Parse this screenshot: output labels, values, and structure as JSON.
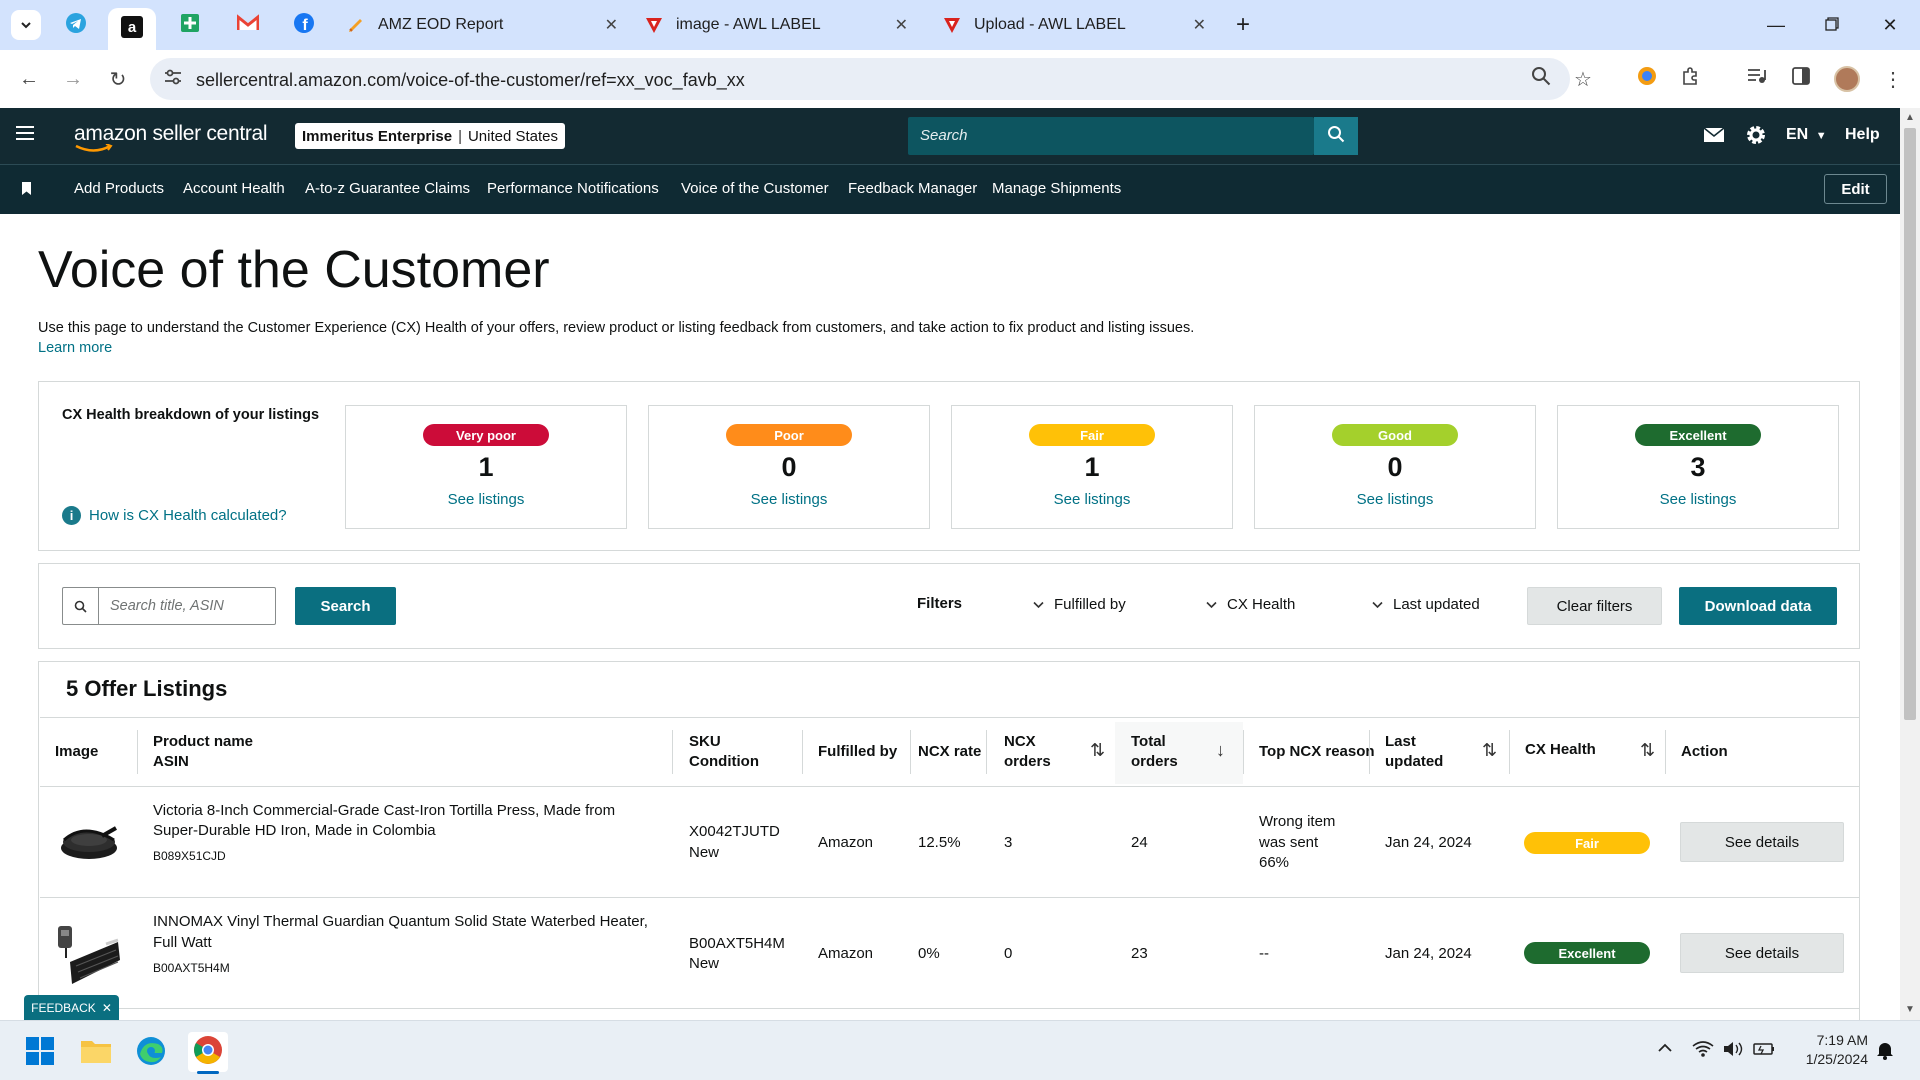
{
  "browser": {
    "tabs": [
      {
        "title": "AMZ EOD Report"
      },
      {
        "title": "image - AWL LABEL"
      },
      {
        "title": "Upload - AWL LABEL"
      }
    ],
    "url": "sellercentral.amazon.com/voice-of-the-customer/ref=xx_voc_favb_xx"
  },
  "header": {
    "logo": "amazon seller central",
    "store_name": "Immeritus Enterprise",
    "marketplace": "United States",
    "search_placeholder": "Search",
    "language": "EN",
    "help": "Help"
  },
  "nav": {
    "items": [
      "Add Products",
      "Account Health",
      "A-to-z Guarantee Claims",
      "Performance Notifications",
      "Voice of the Customer",
      "Feedback Manager",
      "Manage Shipments"
    ],
    "edit": "Edit"
  },
  "page": {
    "title": "Voice of the Customer",
    "description": "Use this page to understand the Customer Experience (CX) Health of your offers, review product or listing feedback from customers, and take action to fix product and listing issues.",
    "learn_more": "Learn more"
  },
  "breakdown": {
    "heading": "CX Health breakdown of your listings",
    "how_link": "How is CX Health calculated?",
    "cards": [
      {
        "label": "Very poor",
        "count": "1",
        "link": "See listings",
        "color": "#cc0c39"
      },
      {
        "label": "Poor",
        "count": "0",
        "link": "See listings",
        "color": "#ff8c1a"
      },
      {
        "label": "Fair",
        "count": "1",
        "link": "See listings",
        "color": "#ffc107"
      },
      {
        "label": "Good",
        "count": "0",
        "link": "See listings",
        "color": "#a4d02c"
      },
      {
        "label": "Excellent",
        "count": "3",
        "link": "See listings",
        "color": "#1e6b2f"
      }
    ]
  },
  "filters": {
    "search_placeholder": "Search title, ASIN",
    "search_button": "Search",
    "filters_label": "Filters",
    "fulfilled_by": "Fulfilled by",
    "cx_health": "CX Health",
    "last_updated": "Last updated",
    "clear": "Clear filters",
    "download": "Download data"
  },
  "listings": {
    "heading": "5 Offer Listings",
    "columns": {
      "image": "Image",
      "product_name": "Product name",
      "asin": "ASIN",
      "sku": "SKU",
      "condition": "Condition",
      "fulfilled_by": "Fulfilled by",
      "ncx_rate": "NCX rate",
      "ncx_orders_1": "NCX",
      "ncx_orders_2": "orders",
      "total_orders_1": "Total",
      "total_orders_2": "orders",
      "top_reason": "Top NCX reason",
      "last_updated_1": "Last",
      "last_updated_2": "updated",
      "cx_health": "CX Health",
      "action": "Action"
    },
    "rows": [
      {
        "name_line1": "Victoria 8-Inch Commercial-Grade Cast-Iron Tortilla Press, Made from",
        "name_line2": "Super-Durable HD Iron, Made in Colombia",
        "asin": "B089X51CJD",
        "sku": "X0042TJUTD",
        "condition": "New",
        "fulfilled_by": "Amazon",
        "ncx_rate": "12.5%",
        "ncx_orders": "3",
        "total_orders": "24",
        "reason_line1": "Wrong item",
        "reason_line2": "was sent",
        "reason_line3": "66%",
        "last_updated": "Jan 24, 2024",
        "cx_health": "Fair",
        "cx_color": "#ffc107",
        "action": "See details"
      },
      {
        "name_line1": "INNOMAX Vinyl Thermal Guardian Quantum Solid State Waterbed Heater,",
        "name_line2": "Full Watt",
        "asin": "B00AXT5H4M",
        "sku": "B00AXT5H4M",
        "condition": "New",
        "fulfilled_by": "Amazon",
        "ncx_rate": "0%",
        "ncx_orders": "0",
        "total_orders": "23",
        "reason_line1": "--",
        "last_updated": "Jan 24, 2024",
        "cx_health": "Excellent",
        "cx_color": "#1e6b2f",
        "action": "See details"
      }
    ]
  },
  "feedback_tab": "FEEDBACK",
  "taskbar": {
    "time": "7:19 AM",
    "date": "1/25/2024"
  }
}
